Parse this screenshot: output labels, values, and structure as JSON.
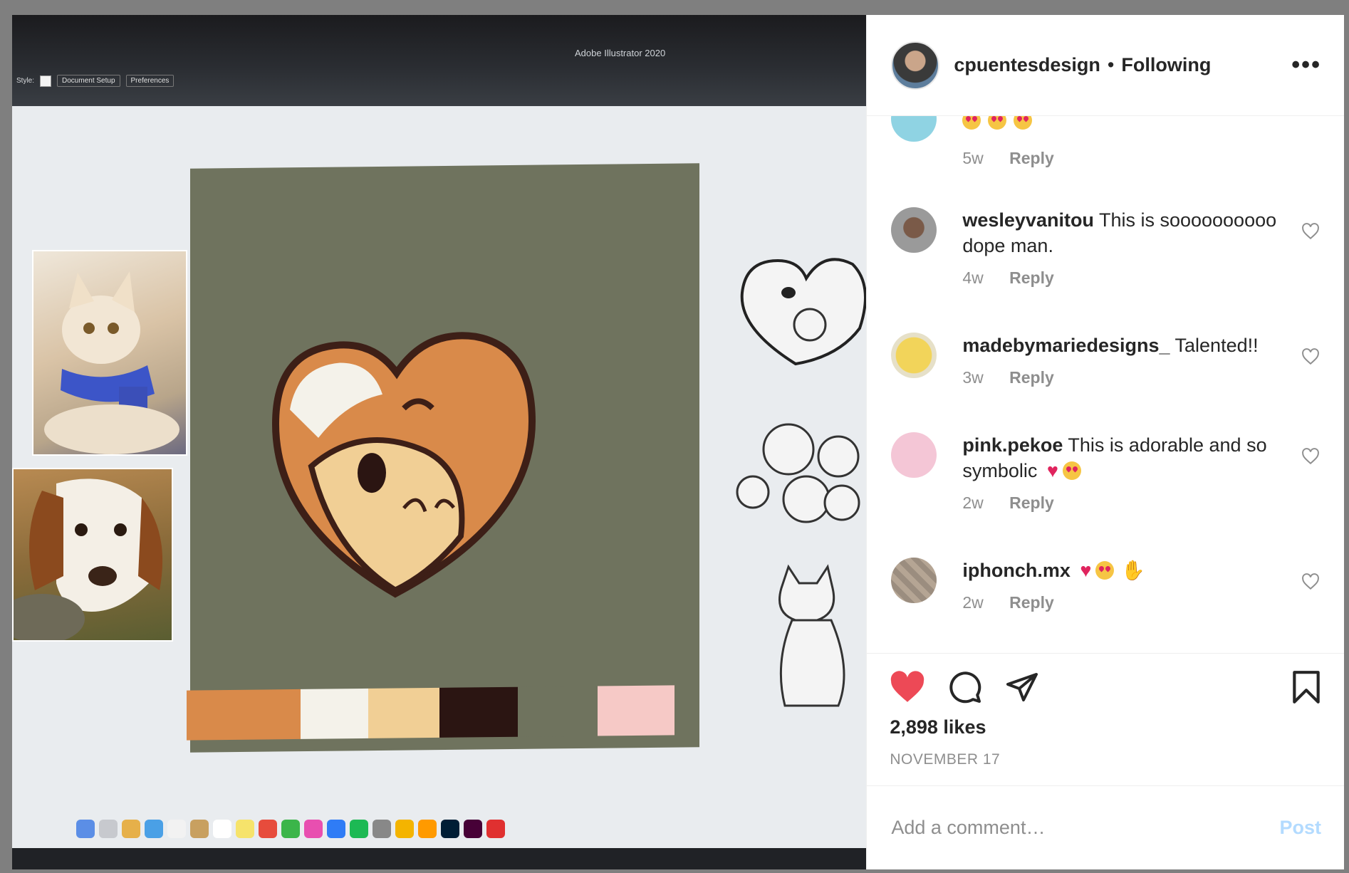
{
  "photo": {
    "app_title": "Adobe Illustrator 2020",
    "toolbar": {
      "style_label": "Style:",
      "doc_setup": "Document Setup",
      "preferences": "Preferences"
    },
    "palette": [
      "#d98a4a",
      "#f4f2ea",
      "#f1cf95",
      "#2b1512",
      "#6f735e",
      "#f6c9c6"
    ]
  },
  "header": {
    "username": "cpuentesdesign",
    "separator": "•",
    "follow_status": "Following",
    "more": "•••"
  },
  "comments": [
    {
      "user": "",
      "text": "",
      "emoji": 3,
      "age": "5w",
      "reply": "Reply",
      "avatar_color": "#8fd3e3"
    },
    {
      "user": "wesleyvanitou",
      "text": "This is soooooooooo dope man.",
      "age": "4w",
      "reply": "Reply",
      "avatar_color": "#6e6e6e"
    },
    {
      "user": "madebymariedesigns_",
      "text": "Talented!!",
      "age": "3w",
      "reply": "Reply",
      "avatar_color": "#e3c24a"
    },
    {
      "user": "pink.pekoe",
      "text": "This is adorable and so symbolic",
      "age": "2w",
      "reply": "Reply",
      "avatar_color": "#f4c6d6"
    },
    {
      "user": "iphonch.mx",
      "text": "",
      "age": "2w",
      "reply": "Reply",
      "avatar_color": "#9b8d7f"
    }
  ],
  "actions": {
    "likes": "2,898 likes",
    "date": "NOVEMBER 17",
    "like_color": "#ed4956"
  },
  "add_comment": {
    "placeholder": "Add a comment…",
    "post_label": "Post"
  }
}
